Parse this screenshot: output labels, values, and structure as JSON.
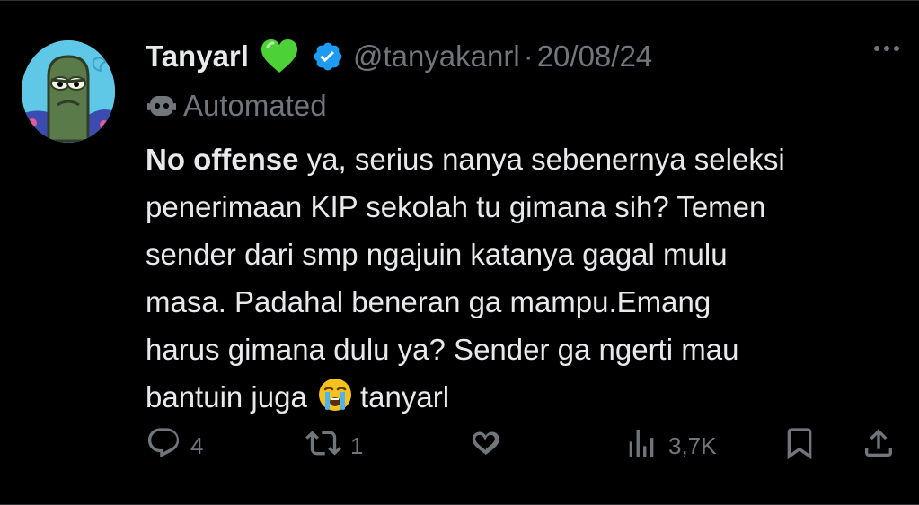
{
  "tweet": {
    "author": {
      "name": "Tanyarl",
      "handle": "@tanyakanrl",
      "verified": true,
      "name_emoji": "green-heart"
    },
    "separator": "·",
    "date": "20/08/24",
    "automated_label": "Automated",
    "body": {
      "lines": [
        {
          "bold": "No offense",
          "text": " ya, serius nanya sebenernya seleksi"
        },
        {
          "text": "penerimaan KIP sekolah tu gimana sih? Temen"
        },
        {
          "text": "sender dari smp ngajuin katanya gagal mulu"
        },
        {
          "text": "masa. Padahal beneran ga mampu.Emang"
        },
        {
          "text": "harus gimana dulu ya? Sender ga ngerti mau"
        },
        {
          "text_before_emoji": "bantuin juga",
          "emoji": "loudly-crying-face",
          "text_after_emoji": "tanyarl"
        }
      ]
    },
    "actions": {
      "reply_count": "4",
      "retweet_count": "1",
      "like_count": "",
      "views_count": "3,7K"
    }
  },
  "colors": {
    "background": "#000000",
    "text": "#e7e9ea",
    "secondary": "#71767b",
    "verified_blue": "#1d9bf0",
    "heart_green": "#4cd137"
  },
  "icons": [
    "more-icon",
    "verified-badge-icon",
    "green-heart-icon",
    "bot-icon",
    "reply-icon",
    "retweet-icon",
    "like-icon",
    "views-icon",
    "bookmark-icon",
    "share-icon"
  ]
}
